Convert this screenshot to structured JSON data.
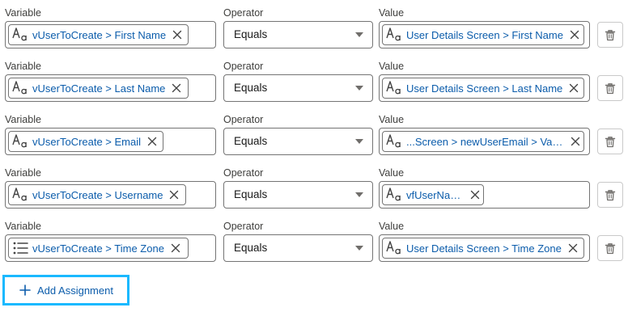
{
  "labels": {
    "variable": "Variable",
    "operator": "Operator",
    "value": "Value"
  },
  "rows": [
    {
      "variable": {
        "text": "vUserToCreate > First Name",
        "icon": "text-type-icon"
      },
      "operator": "Equals",
      "value": {
        "text": "User Details Screen > First Name",
        "icon": "text-type-icon"
      }
    },
    {
      "variable": {
        "text": "vUserToCreate > Last Name",
        "icon": "text-type-icon"
      },
      "operator": "Equals",
      "value": {
        "text": "User Details Screen > Last Name",
        "icon": "text-type-icon"
      }
    },
    {
      "variable": {
        "text": "vUserToCreate > Email",
        "icon": "text-type-icon"
      },
      "operator": "Equals",
      "value": {
        "text": "...Screen > newUserEmail > Value",
        "icon": "text-type-icon"
      }
    },
    {
      "variable": {
        "text": "vUserToCreate > Username",
        "icon": "text-type-icon"
      },
      "operator": "Equals",
      "value": {
        "text": "vfUserName",
        "icon": "text-type-icon"
      }
    },
    {
      "variable": {
        "text": "vUserToCreate > Time Zone",
        "icon": "picklist-icon"
      },
      "operator": "Equals",
      "value": {
        "text": "User Details Screen > Time Zone",
        "icon": "text-type-icon"
      }
    }
  ],
  "add_button": {
    "label": "Add Assignment",
    "icon": "plus-icon"
  },
  "colors": {
    "pill_text": "#0b5cab",
    "focus_ring": "#1ab9ff",
    "border": "#747474"
  }
}
